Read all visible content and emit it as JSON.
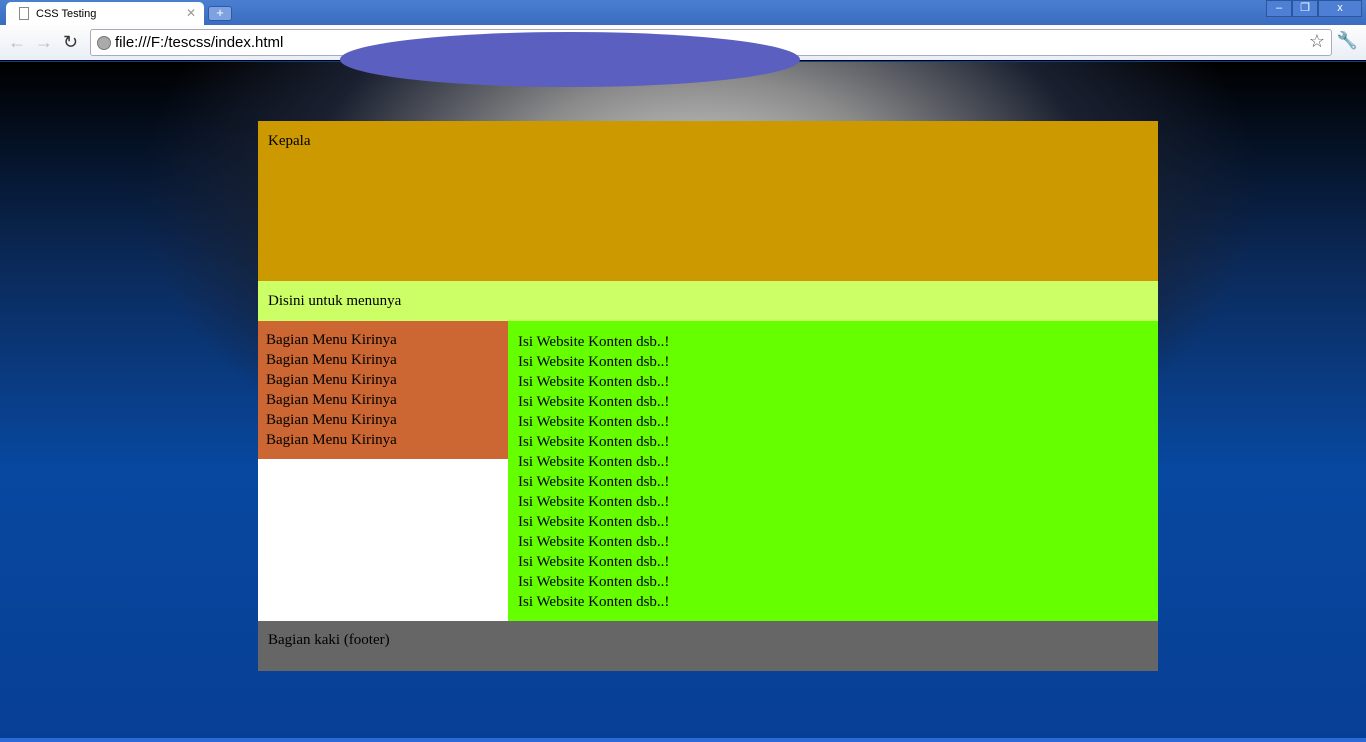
{
  "browser": {
    "tab_title": "CSS Testing",
    "url": "file:///F:/tescss/index.html",
    "window_buttons": [
      "–",
      "❐",
      "x"
    ]
  },
  "page": {
    "header": "Kepala",
    "menu": "Disini untuk menunya",
    "left_menu": [
      "Bagian Menu Kirinya",
      "Bagian Menu Kirinya",
      "Bagian Menu Kirinya",
      "Bagian Menu Kirinya",
      "Bagian Menu Kirinya",
      "Bagian Menu Kirinya"
    ],
    "content": [
      "Isi Website Konten dsb..!",
      "Isi Website Konten dsb..!",
      "Isi Website Konten dsb..!",
      "Isi Website Konten dsb..!",
      "Isi Website Konten dsb..!",
      "Isi Website Konten dsb..!",
      "Isi Website Konten dsb..!",
      "Isi Website Konten dsb..!",
      "Isi Website Konten dsb..!",
      "Isi Website Konten dsb..!",
      "Isi Website Konten dsb..!",
      "Isi Website Konten dsb..!",
      "Isi Website Konten dsb..!",
      "Isi Website Konten dsb..!"
    ],
    "footer": "Bagian kaki (footer)"
  },
  "colors": {
    "header": "#cc9900",
    "menu": "#ccff66",
    "left": "#cc6633",
    "content": "#66ff00",
    "footer": "#666666"
  }
}
